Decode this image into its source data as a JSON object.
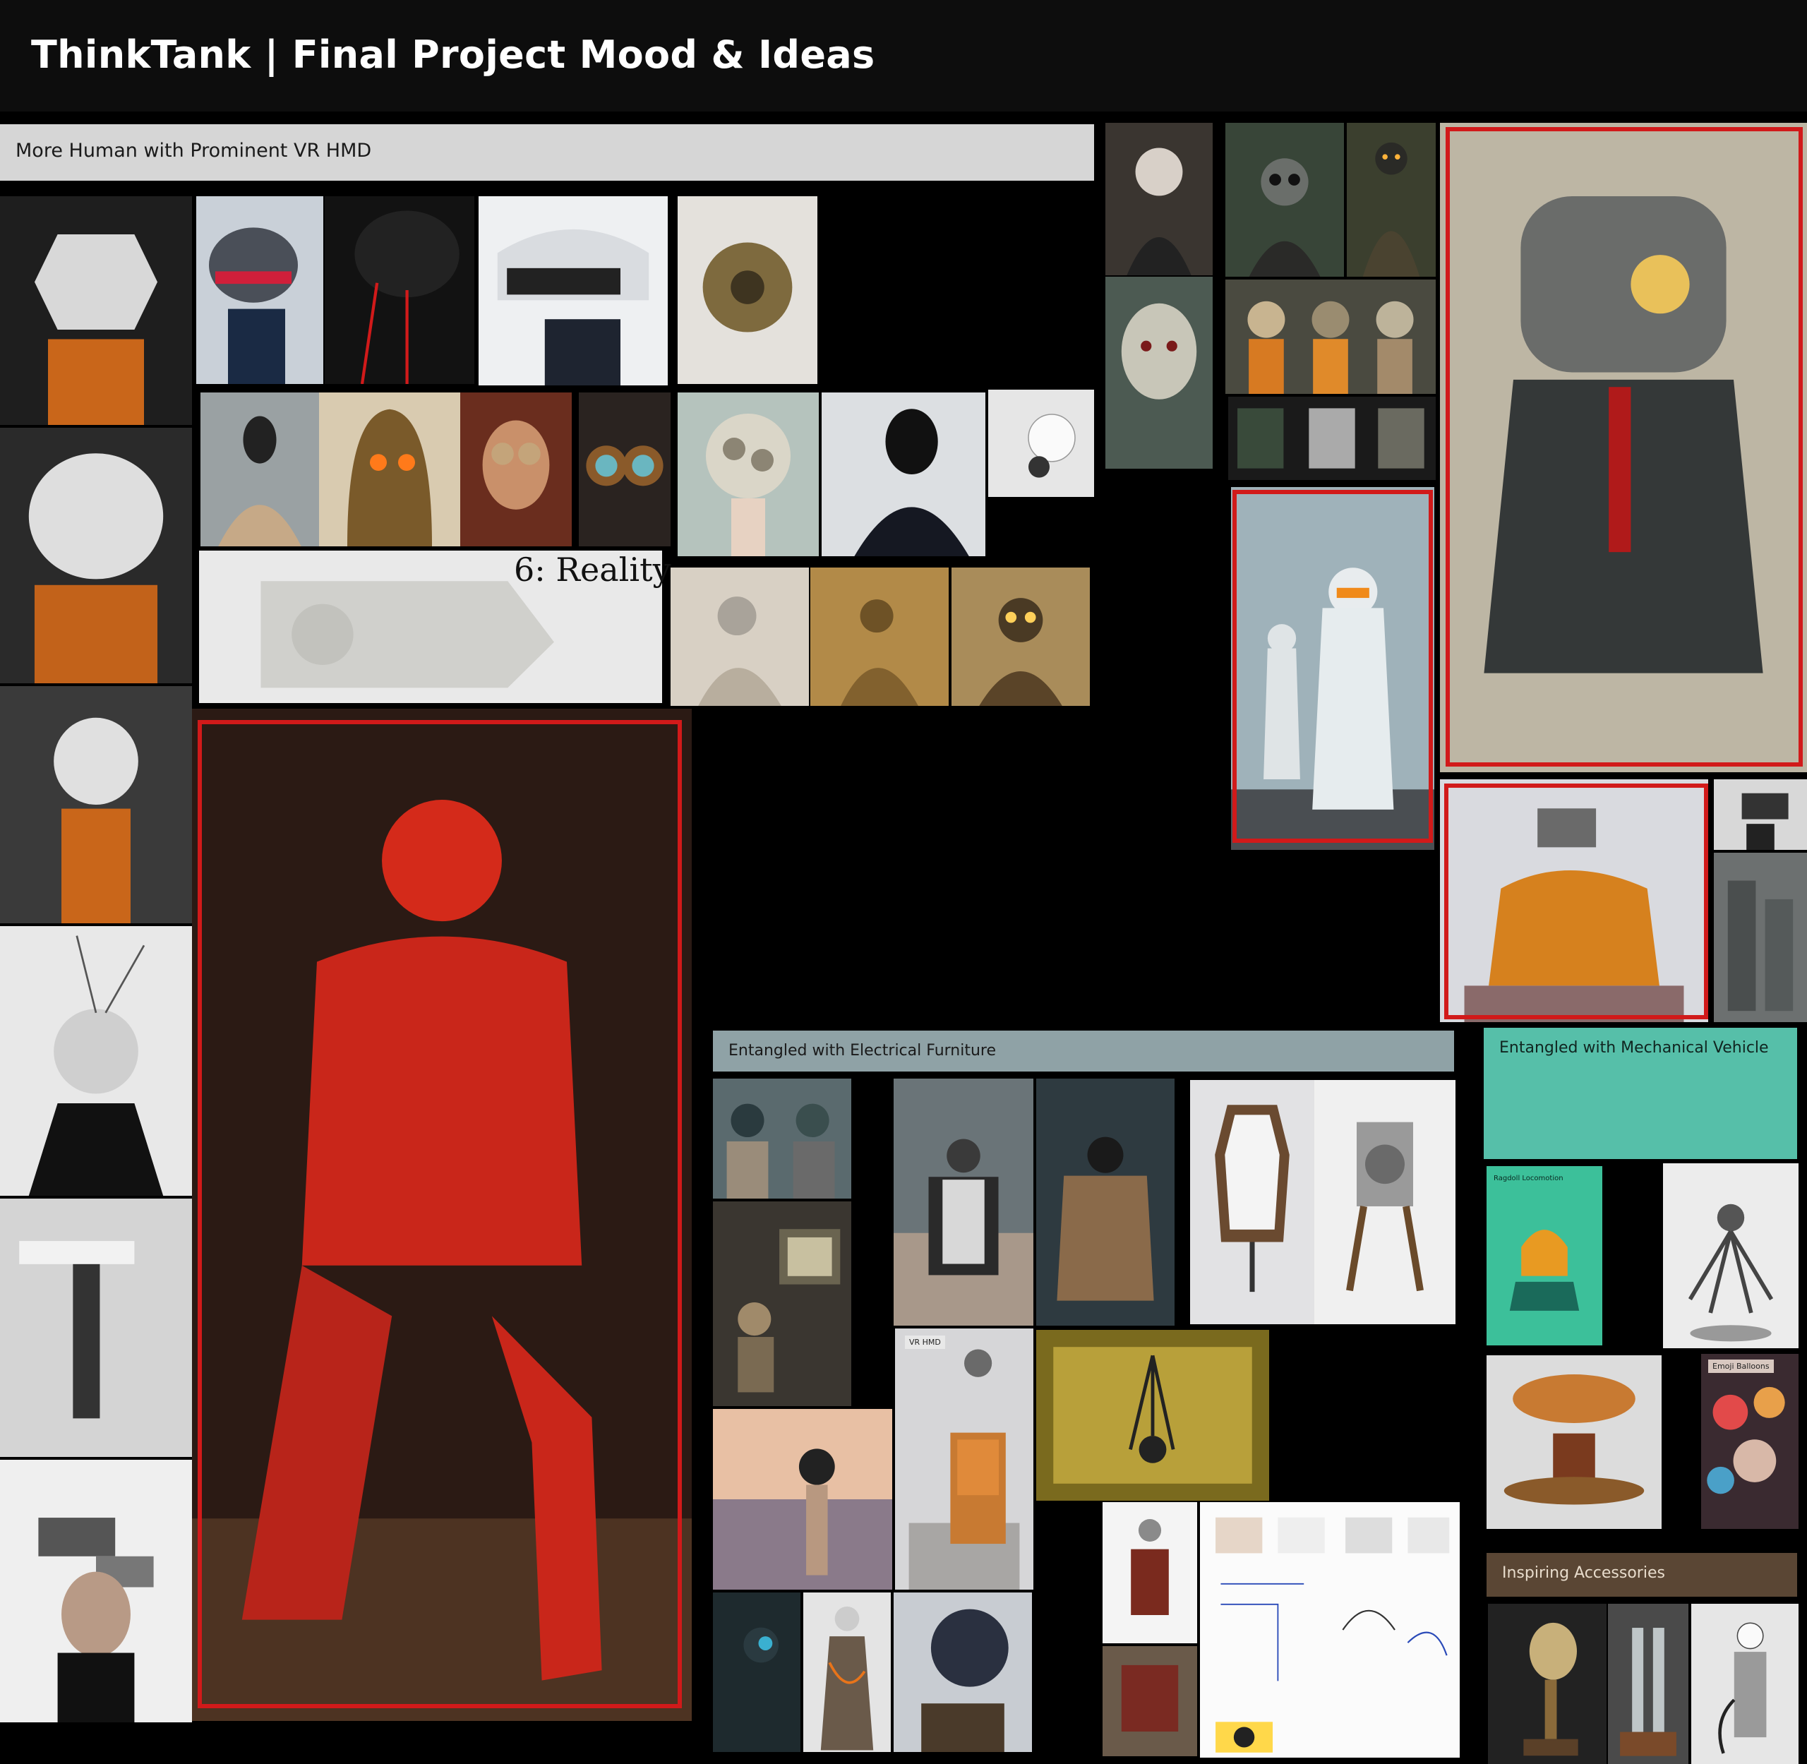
{
  "board": {
    "title": "ThinkTank | Final Project Mood & Ideas"
  },
  "sections": {
    "vr_hmd": {
      "label": "More Human with Prominent VR HMD",
      "bg": "#d6d6d6"
    },
    "electrical_furniture": {
      "label": "Entangled with Electrical Furniture",
      "bg": "#8fa2a6"
    },
    "mechanical_vehicle": {
      "label": "Entangled with Mechanical Vehicle",
      "bg": "#56bfa9"
    },
    "accessories": {
      "label": "Inspiring Accessories",
      "bg": "#5a4634"
    }
  },
  "image_text": {
    "reality": "6: Reality",
    "vr_hmd_tag": "VR HMD",
    "ragdoll_tag": "Ragdoll Locomotion",
    "balloons_tag": "Emoji Balloons"
  },
  "colors": {
    "highlight_frame": "#d11a1a"
  }
}
